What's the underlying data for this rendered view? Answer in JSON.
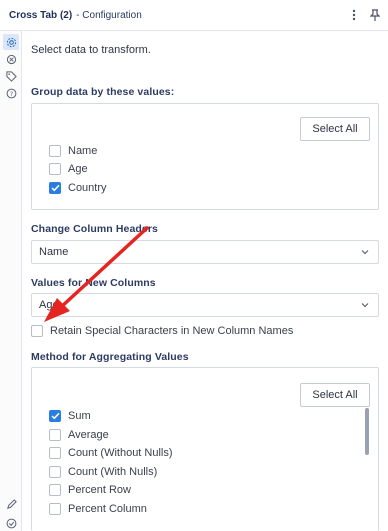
{
  "header": {
    "title": "Cross Tab (2)",
    "subtitle": "- Configuration"
  },
  "left_rail": {
    "icons": [
      "gear-icon",
      "settings-icon",
      "tag-icon",
      "help-icon",
      "pencil-icon",
      "checkmark-icon"
    ]
  },
  "intro": "Select data to transform.",
  "group_by": {
    "label": "Group data by these values:",
    "select_all": "Select All",
    "items": [
      {
        "label": "Name",
        "checked": false
      },
      {
        "label": "Age",
        "checked": false
      },
      {
        "label": "Country",
        "checked": true
      }
    ]
  },
  "change_headers": {
    "label": "Change Column Headers",
    "value": "Name"
  },
  "values_new_columns": {
    "label": "Values for New Columns",
    "value": "Age"
  },
  "retain": {
    "label": "Retain Special Characters in New Column Names",
    "checked": false
  },
  "aggregate": {
    "label": "Method for Aggregating Values",
    "select_all": "Select All",
    "items": [
      {
        "label": "Sum",
        "checked": true
      },
      {
        "label": "Average",
        "checked": false
      },
      {
        "label": "Count (Without Nulls)",
        "checked": false
      },
      {
        "label": "Count (With Nulls)",
        "checked": false
      },
      {
        "label": "Percent Row",
        "checked": false
      },
      {
        "label": "Percent Column",
        "checked": false
      }
    ]
  },
  "colors": {
    "accent": "#2a7ee0",
    "arrow": "#e52520",
    "header_text": "#1f2d5a"
  }
}
